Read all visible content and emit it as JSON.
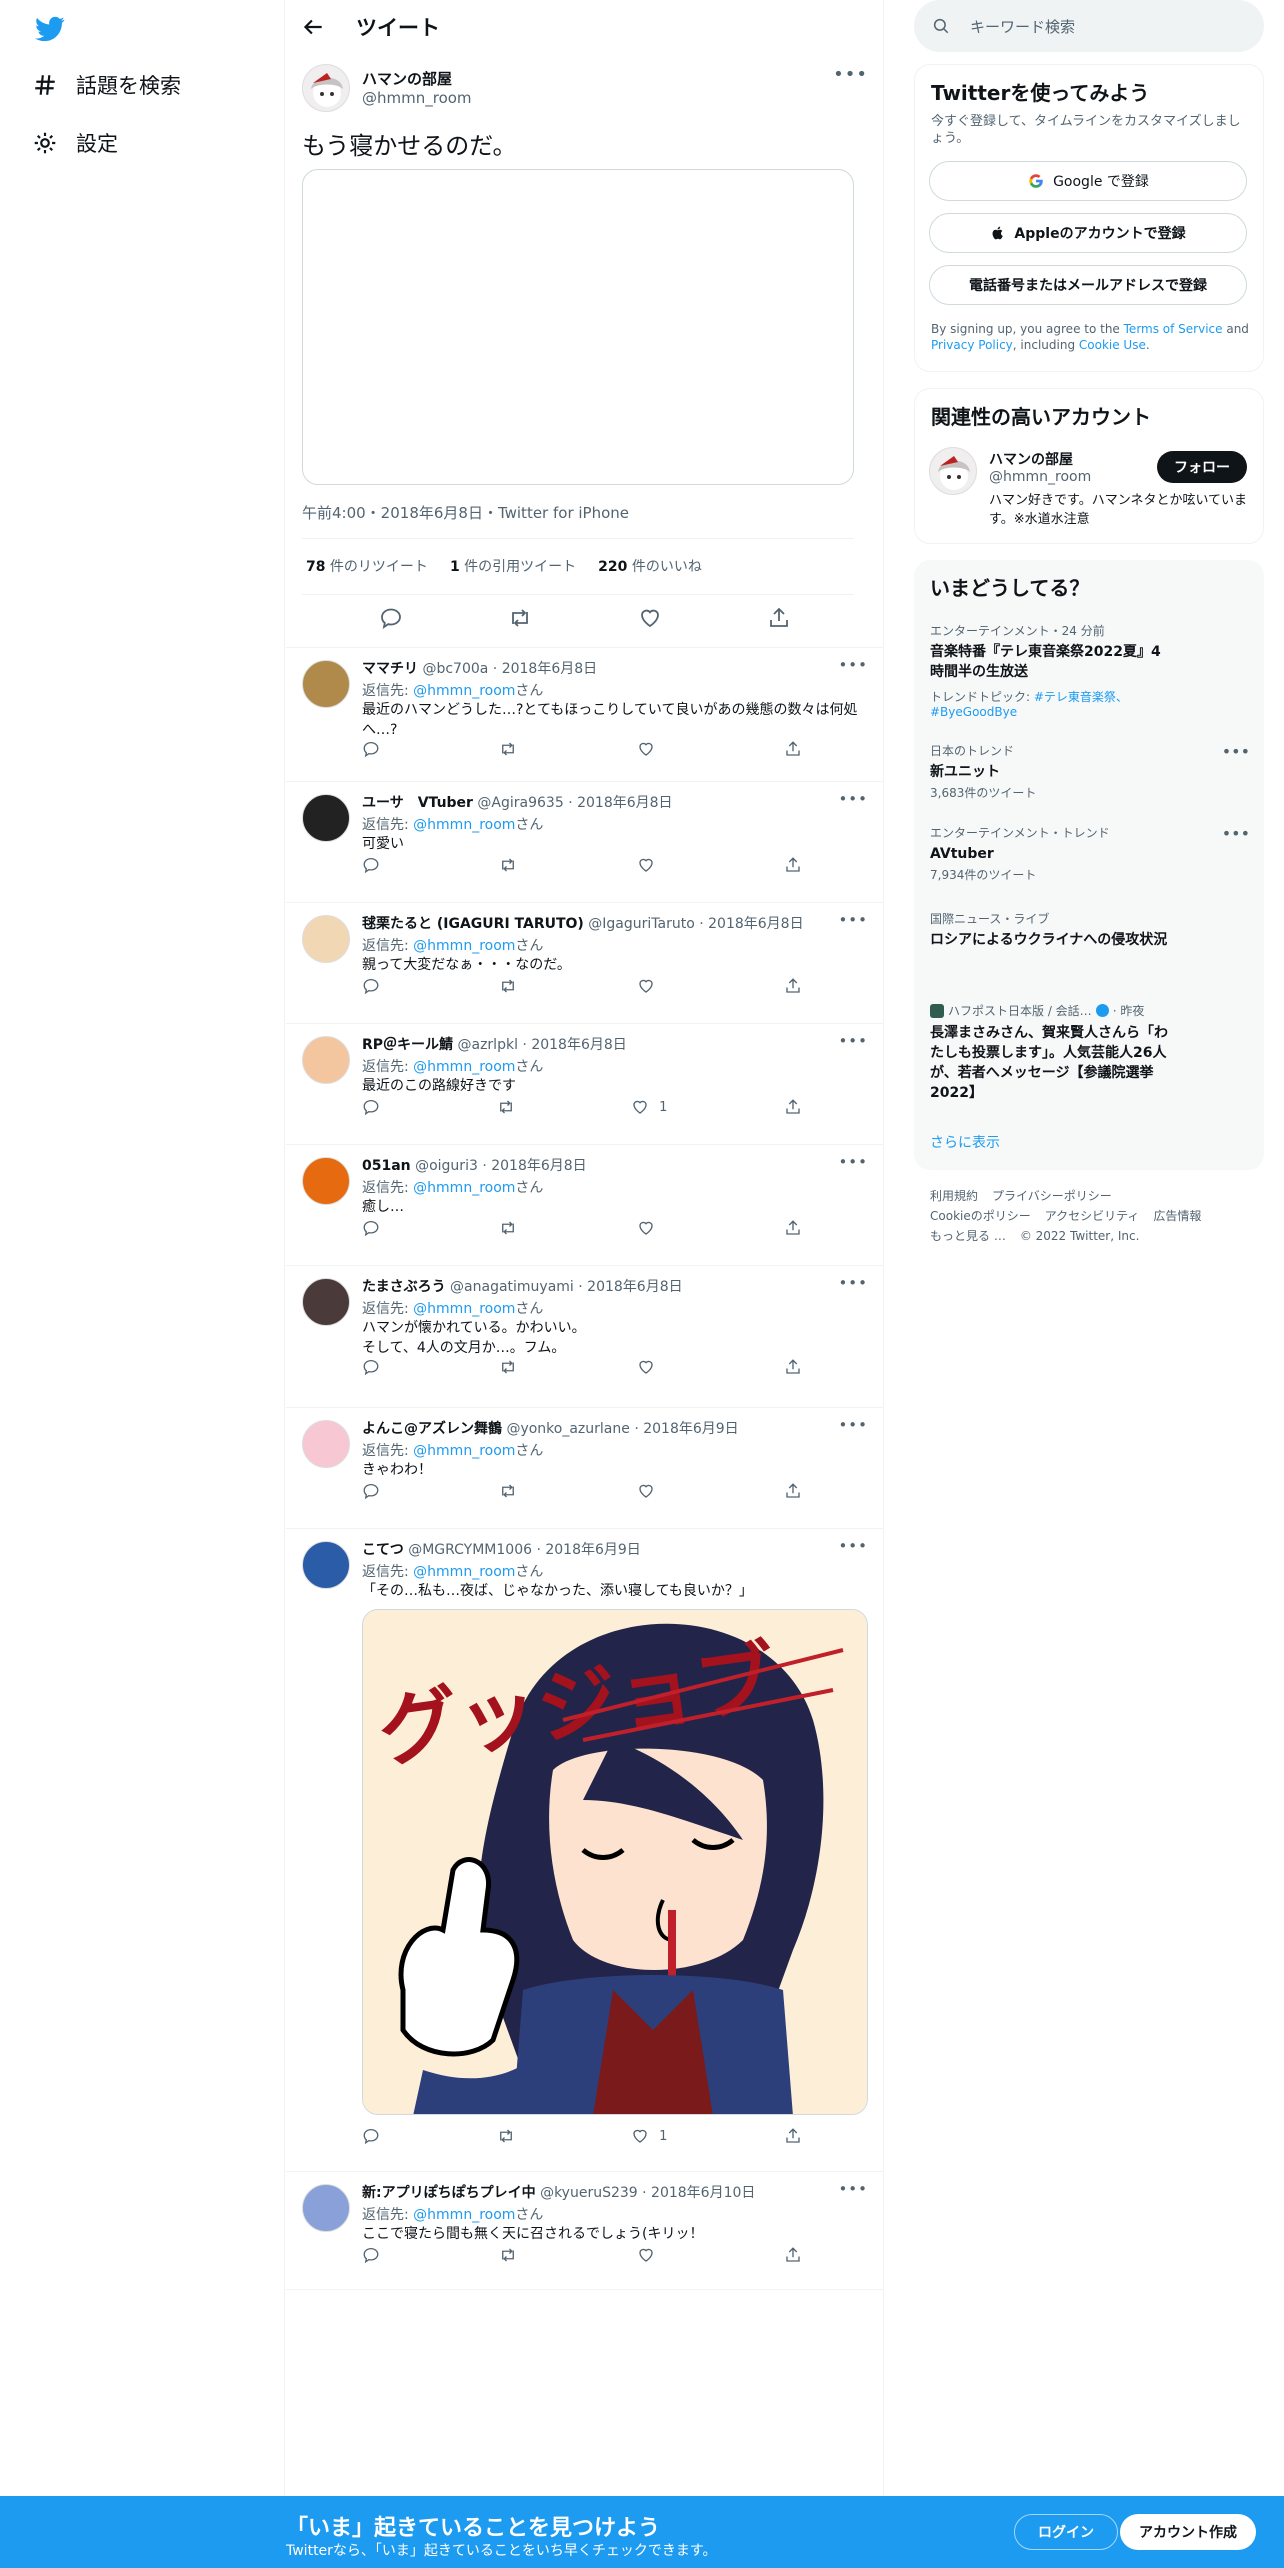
{
  "nav": {
    "explore": "話題を検索",
    "settings": "設定"
  },
  "header": {
    "title": "ツイート"
  },
  "main_tweet": {
    "name": "ハマンの部屋",
    "handle": "@hmmn_room",
    "text": "もう寝かせるのだ。",
    "meta": "午前4:00・2018年6月8日・Twitter for iPhone",
    "retweets_count": "78",
    "retweets_label": " 件のリツイート",
    "quotes_count": "1",
    "quotes_label": " 件の引用ツイート",
    "likes_count": "220",
    "likes_label": " 件のいいね"
  },
  "reply_prefix": "返信先: ",
  "reply_mention": "@hmmn_room",
  "reply_suffix": "さん",
  "replies": [
    {
      "name": "ママチリ",
      "handle": "@bc700a",
      "date": " · 2018年6月8日",
      "text": "最近のハマンどうした…?とてもほっこりしていて良いがあの幾態の数々は何処へ…?",
      "likes": ""
    },
    {
      "name": "ユーサ　VTuber",
      "handle": "@Agira9635",
      "date": " · 2018年6月8日",
      "text": "可愛い",
      "likes": ""
    },
    {
      "name": "毬栗たると (IGAGURI TARUTO)",
      "handle": "@IgaguriTaruto",
      "date": " · 2018年6月8日",
      "text": "親って大変だなぁ・・・なのだ。",
      "likes": ""
    },
    {
      "name": "RP＠キール鯖",
      "handle": "@azrlpkl",
      "date": " · 2018年6月8日",
      "text": "最近のこの路線好きです",
      "likes": "1"
    },
    {
      "name": "051an",
      "handle": "@oiguri3",
      "date": " · 2018年6月8日",
      "text": "癒し…",
      "likes": ""
    },
    {
      "name": "たまさぶろう",
      "handle": "@anagatimuyami",
      "date": " · 2018年6月8日",
      "text": "ハマンが懐かれている。かわいい。\nそして、4人の文月か…。フム。",
      "likes": ""
    },
    {
      "name": "よんこ@アズレン舞鶴",
      "handle": "@yonko_azurlane",
      "date": " · 2018年6月9日",
      "text": "きゃわわ！",
      "likes": ""
    },
    {
      "name": "こてつ",
      "handle": "@MGRCYMM1006",
      "date": " · 2018年6月9日",
      "text": "「その…私も…夜ば、じゃなかった、添い寝しても良いか？」",
      "likes": "1",
      "media_text": "グッジョブ"
    },
    {
      "name": "新:アプリぽちぽちプレイ中",
      "handle": "@kyueruS239",
      "date": " · 2018年6月10日",
      "text": "ここで寝たら間も無く天に召されるでしょう(キリッ！",
      "likes": ""
    }
  ],
  "search": {
    "placeholder": "キーワード検索"
  },
  "signup_panel": {
    "title": "Twitterを使ってみよう",
    "subtitle": "今すぐ登録して、タイムラインをカスタマイズしましょう。",
    "google_button": "Google で登録",
    "apple_button": "Appleのアカウントで登録",
    "phone_button": "電話番号またはメールアドレスで登録",
    "terms_prefix": "By signing up, you agree to the ",
    "terms_link": "Terms of Service",
    "terms_and": " and ",
    "privacy_link": "Privacy Policy",
    "including": ", including ",
    "cookie_link": "Cookie Use",
    "period": "."
  },
  "related_panel": {
    "title": "関連性の高いアカウント",
    "name": "ハマンの部屋",
    "handle": "@hmmn_room",
    "follow_button": "フォロー",
    "bio": "ハマン好きです。ハマンネタとか呟いています。※水道水注意"
  },
  "trends_panel": {
    "title": "いまどうしてる？",
    "trends": [
      {
        "category": "エンターテインメント・24 分前",
        "name": "音楽特番『テレ東音楽祭2022夏』4時間半の生放送",
        "topic_prefix": "トレンドトピック: ",
        "topic_links": "#テレ東音楽祭、#ByeGoodBye"
      },
      {
        "category": "日本のトレンド",
        "name": "新ユニット",
        "count": "3,683件のツイート"
      },
      {
        "category": "エンターテインメント・トレンド",
        "name": "AVtuber",
        "count": "7,934件のツイート"
      },
      {
        "category": "国際ニュース・ライブ",
        "name": "ロシアによるウクライナへの侵攻状況"
      },
      {
        "source": "ハフポスト日本版 / 会話…",
        "time": " · 昨夜",
        "name": "長澤まさみさん、賀来賢人さんら「わたしも投票します」。人気芸能人26人が、若者へメッセージ【参議院選挙2022】"
      }
    ],
    "show_more": "さらに表示"
  },
  "footer": {
    "links": [
      "利用規約",
      "プライバシーポリシー",
      "Cookieのポリシー",
      "アクセシビリティ",
      "広告情報",
      "もっと見る …"
    ],
    "copyright": "© 2022 Twitter, Inc."
  },
  "bottom_bar": {
    "title": "「いま」起きていることを見つけよう",
    "subtitle": "Twitterなら、「いま」起きていることをいち早くチェックできます。",
    "login": "ログイン",
    "signup": "アカウント作成"
  },
  "colors": {
    "accent": "#1d9bf0",
    "text": "#0f1419",
    "muted": "#536471",
    "border": "#eff3f4"
  }
}
